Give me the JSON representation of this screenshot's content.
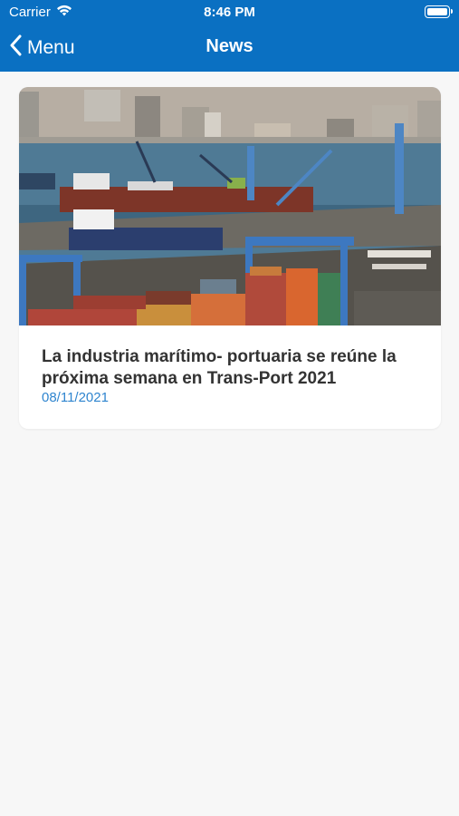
{
  "status_bar": {
    "carrier": "Carrier",
    "time": "8:46 PM",
    "icons": [
      "wifi-icon",
      "battery-icon"
    ]
  },
  "nav": {
    "back_label": "Menu",
    "title": "News",
    "bar_color": "#0a70c2"
  },
  "news": [
    {
      "title": "La industria marítimo- portuaria se reúne la próxima semana en Trans-Port 2021",
      "date": "08/11/2021",
      "date_color": "#2f85cf"
    }
  ]
}
